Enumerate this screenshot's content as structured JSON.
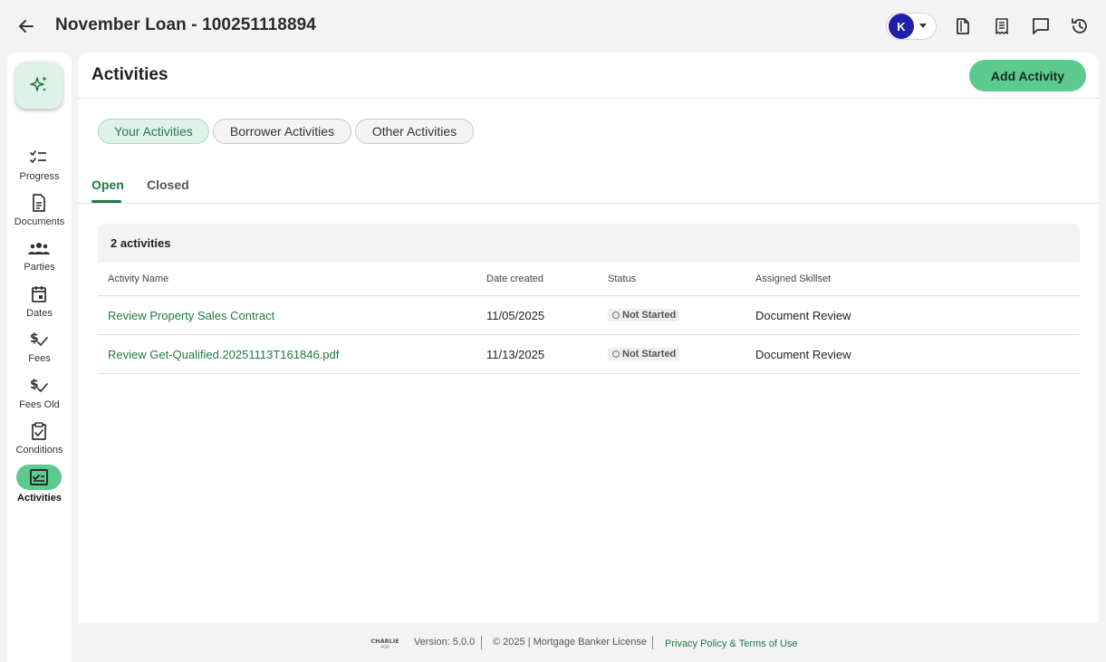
{
  "header": {
    "title": "November Loan - 100251118894",
    "user_initial": "K",
    "back_icon": "arrow-left-icon",
    "icons": [
      "file-icon",
      "receipt-icon",
      "chat-icon",
      "history-icon"
    ]
  },
  "sidebar": {
    "ai_icon": "sparkle-icon",
    "items": [
      {
        "label": "Progress",
        "icon": "checklist-icon"
      },
      {
        "label": "Documents",
        "icon": "document-icon"
      },
      {
        "label": "Parties",
        "icon": "people-icon"
      },
      {
        "label": "Dates",
        "icon": "calendar-icon"
      },
      {
        "label": "Fees",
        "icon": "dollar-check-icon"
      },
      {
        "label": "Fees Old",
        "icon": "dollar-check-icon"
      },
      {
        "label": "Conditions",
        "icon": "clipboard-check-icon"
      },
      {
        "label": "Activities",
        "icon": "activity-check-icon",
        "active": true
      }
    ]
  },
  "main": {
    "title": "Activities",
    "add_button": "Add Activity",
    "chips": [
      "Your Activities",
      "Borrower Activities",
      "Other Activities"
    ],
    "selected_chip": "Your Activities",
    "tabs": [
      "Open",
      "Closed"
    ],
    "active_tab": "Open",
    "table": {
      "count_label": "2 activities",
      "columns": [
        "Activity Name",
        "Date created",
        "Status",
        "Assigned Skillset"
      ],
      "rows": [
        {
          "name": "Review Property Sales Contract",
          "date": "11/05/2025",
          "status": "Not Started",
          "skillset": "Document Review"
        },
        {
          "name": "Review Get-Qualified.20251113T161846.pdf",
          "date": "11/13/2025",
          "status": "Not Started",
          "skillset": "Document Review"
        }
      ]
    }
  },
  "footer": {
    "logo_text": "CHARLIE POP",
    "version": "Version: 5.0.0",
    "license": "© 2025 | Mortgage Banker License",
    "privacy_link": "Privacy Policy & Terms of Use"
  },
  "colors": {
    "accent": "#5cc98f",
    "accent_dark": "#1e7a45",
    "avatar": "#1f1fa8"
  }
}
